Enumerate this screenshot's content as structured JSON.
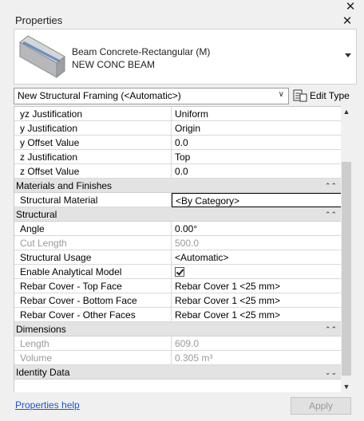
{
  "panel": {
    "title": "Properties"
  },
  "type_selector": {
    "family": "Beam Concrete-Rectangular (M)",
    "type": "NEW CONC BEAM"
  },
  "instance_selector": {
    "value": "New Structural Framing (<Automatic>)"
  },
  "edit_type": {
    "label": "Edit Type"
  },
  "rows_top": [
    {
      "label": "yz Justification",
      "value": "Uniform"
    },
    {
      "label": "y Justification",
      "value": "Origin"
    },
    {
      "label": "y Offset Value",
      "value": "0.0"
    },
    {
      "label": "z Justification",
      "value": "Top"
    },
    {
      "label": "z Offset Value",
      "value": "0.0"
    }
  ],
  "groups": {
    "materials": "Materials and Finishes",
    "structural": "Structural",
    "dimensions": "Dimensions",
    "identity": "Identity Data"
  },
  "materials_rows": [
    {
      "label": "Structural Material",
      "value": "<By Category>"
    }
  ],
  "structural_rows": [
    {
      "label": "Angle",
      "value": "0.00°",
      "disabled": false
    },
    {
      "label": "Cut Length",
      "value": "500.0",
      "disabled": true
    },
    {
      "label": "Structural Usage",
      "value": "<Automatic>",
      "disabled": false
    },
    {
      "label": "Enable Analytical Model",
      "value": "",
      "checked": true,
      "disabled": false
    },
    {
      "label": "Rebar Cover - Top Face",
      "value": "Rebar Cover 1 <25 mm>",
      "disabled": false
    },
    {
      "label": "Rebar Cover - Bottom Face",
      "value": "Rebar Cover 1 <25 mm>",
      "disabled": false
    },
    {
      "label": "Rebar Cover - Other Faces",
      "value": "Rebar Cover 1 <25 mm>",
      "disabled": false
    }
  ],
  "dimension_rows": [
    {
      "label": "Length",
      "value": "609.0",
      "disabled": true
    },
    {
      "label": "Volume",
      "value": "0.305 m³",
      "disabled": true
    }
  ],
  "footer": {
    "help_link": "Properties help",
    "apply_label": "Apply"
  }
}
